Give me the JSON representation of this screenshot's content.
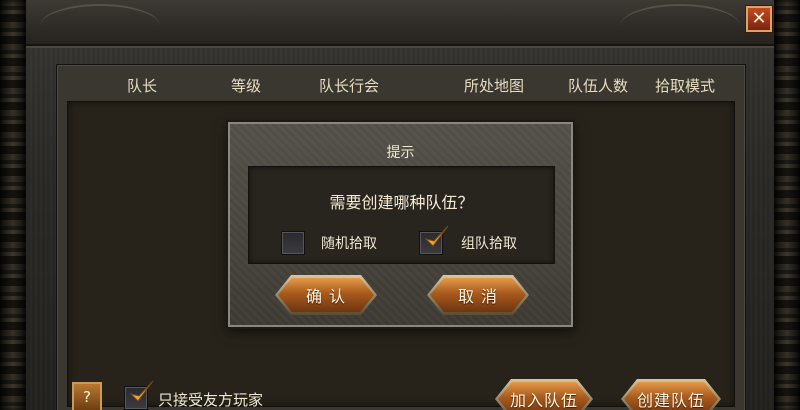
{
  "window": {
    "close_icon": "✕"
  },
  "table": {
    "headers": [
      "队长",
      "等级",
      "队长行会",
      "所处地图",
      "队伍人数",
      "拾取模式"
    ]
  },
  "bottom_bar": {
    "help_label": "?",
    "friendly_only_label": "只接受友方玩家",
    "friendly_only_checked": true,
    "join_team_label": "加入队伍",
    "create_team_label": "创建队伍"
  },
  "dialog": {
    "title": "提示",
    "question": "需要创建哪种队伍？",
    "option_random_label": "随机拾取",
    "option_random_checked": false,
    "option_team_label": "组队拾取",
    "option_team_checked": true,
    "confirm_label": "确 认",
    "cancel_label": "取 消"
  },
  "colors": {
    "accent_orange": "#c06a26",
    "check_gold": "#f0a43a",
    "close_red": "#b03a18"
  }
}
